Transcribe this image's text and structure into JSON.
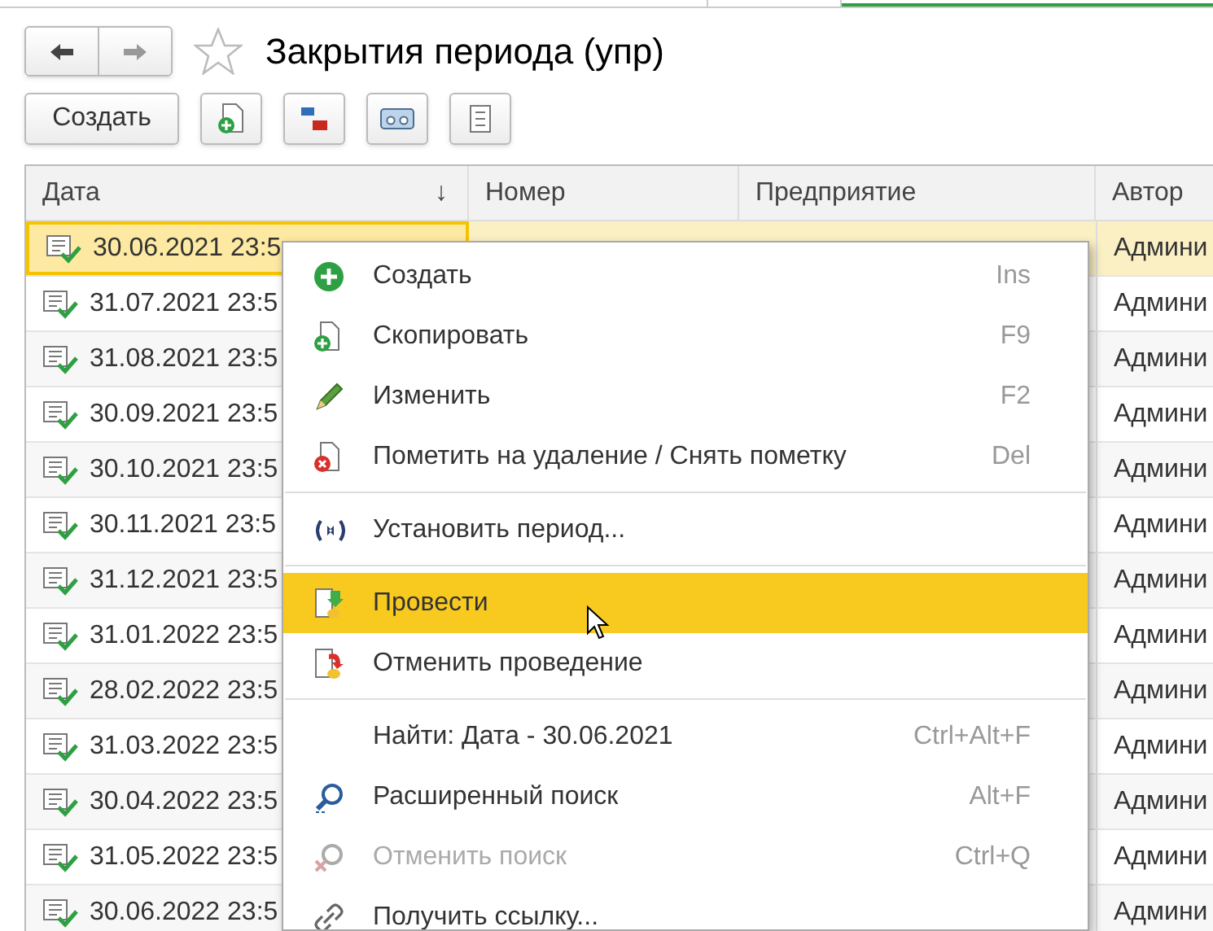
{
  "title": "Закрытия периода (упр)",
  "favorite": false,
  "toolbar": {
    "create_label": "Создать"
  },
  "table": {
    "columns": [
      {
        "label": "Дата",
        "sort": "↓"
      },
      {
        "label": "Номер"
      },
      {
        "label": "Предприятие"
      },
      {
        "label": "Автор"
      }
    ],
    "rows": [
      {
        "date": "30.06.2021 23:5",
        "author": "Админи",
        "selected": true
      },
      {
        "date": "31.07.2021 23:5",
        "author": "Админи",
        "selected": false
      },
      {
        "date": "31.08.2021 23:5",
        "author": "Админи",
        "selected": false
      },
      {
        "date": "30.09.2021 23:5",
        "author": "Админи",
        "selected": false
      },
      {
        "date": "30.10.2021 23:5",
        "author": "Админи",
        "selected": false
      },
      {
        "date": "30.11.2021 23:5",
        "author": "Админи",
        "selected": false
      },
      {
        "date": "31.12.2021 23:5",
        "author": "Админи",
        "selected": false
      },
      {
        "date": "31.01.2022 23:5",
        "author": "Админи",
        "selected": false
      },
      {
        "date": "28.02.2022 23:5",
        "author": "Админи",
        "selected": false
      },
      {
        "date": "31.03.2022 23:5",
        "author": "Админи",
        "selected": false
      },
      {
        "date": "30.04.2022 23:5",
        "author": "Админи",
        "selected": false
      },
      {
        "date": "31.05.2022 23:5",
        "author": "Админи",
        "selected": false
      },
      {
        "date": "30.06.2022 23:5",
        "author": "Админи",
        "selected": false
      }
    ]
  },
  "context_menu": [
    {
      "kind": "item",
      "label": "Создать",
      "shortcut": "Ins",
      "selected": false,
      "disabled": false
    },
    {
      "kind": "item",
      "label": "Скопировать",
      "shortcut": "F9",
      "selected": false,
      "disabled": false
    },
    {
      "kind": "item",
      "label": "Изменить",
      "shortcut": "F2",
      "selected": false,
      "disabled": false
    },
    {
      "kind": "item",
      "label": "Пометить на удаление / Снять пометку",
      "shortcut": "Del",
      "selected": false,
      "disabled": false
    },
    {
      "kind": "separator"
    },
    {
      "kind": "item",
      "label": "Установить период...",
      "selected": false,
      "disabled": false
    },
    {
      "kind": "separator"
    },
    {
      "kind": "item",
      "label": "Провести",
      "selected": true,
      "disabled": false
    },
    {
      "kind": "item",
      "label": "Отменить проведение",
      "selected": false,
      "disabled": false
    },
    {
      "kind": "separator"
    },
    {
      "kind": "item",
      "label": "Найти: Дата - 30.06.2021",
      "shortcut": "Ctrl+Alt+F",
      "selected": false,
      "disabled": false
    },
    {
      "kind": "item",
      "label": "Расширенный поиск",
      "shortcut": "Alt+F",
      "selected": false,
      "disabled": false
    },
    {
      "kind": "item",
      "label": "Отменить поиск",
      "shortcut": "Ctrl+Q",
      "selected": false,
      "disabled": true
    },
    {
      "kind": "item",
      "label": "Получить ссылку...",
      "selected": false,
      "disabled": false
    }
  ]
}
